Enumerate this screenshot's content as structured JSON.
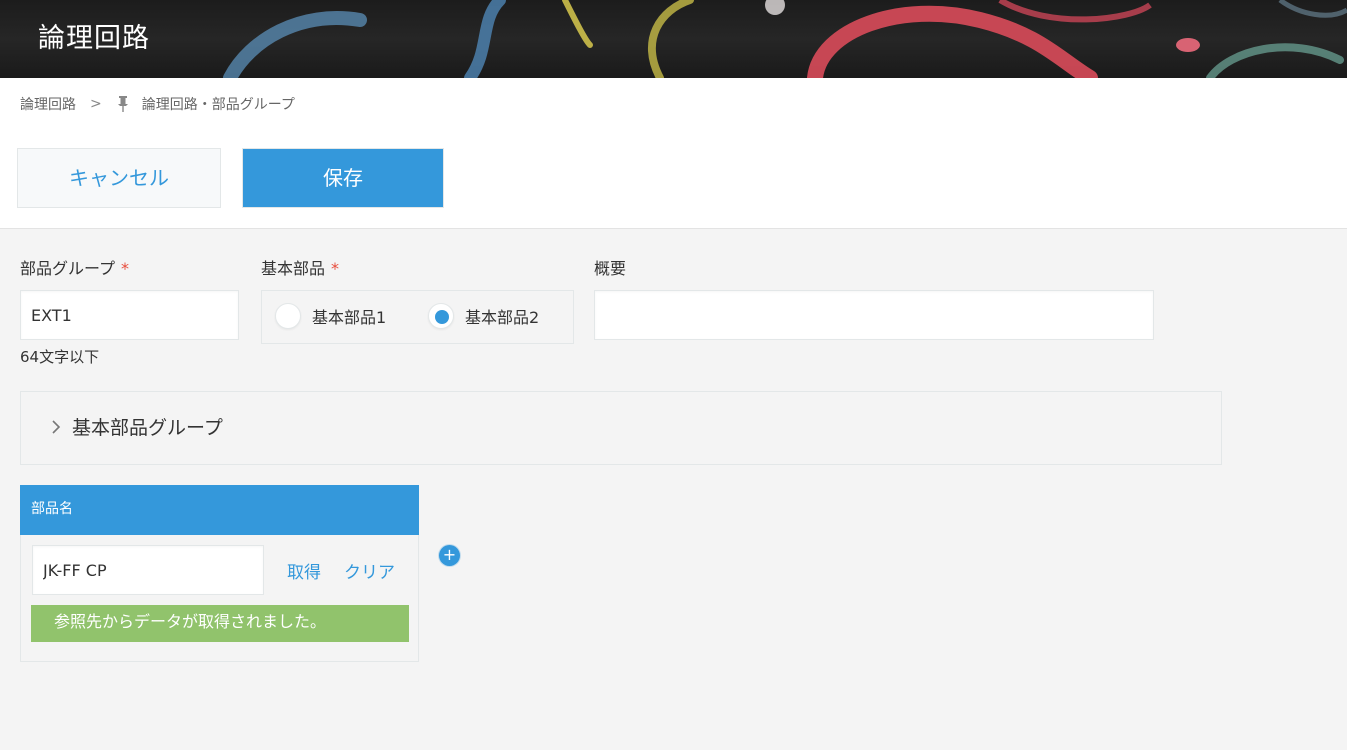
{
  "header": {
    "title": "論理回路"
  },
  "breadcrumb": {
    "parent": "論理回路",
    "separator": ">",
    "current": "論理回路・部品グループ"
  },
  "toolbar": {
    "cancel_label": "キャンセル",
    "save_label": "保存"
  },
  "form": {
    "group_label": "部品グループ",
    "group_required": "*",
    "group_value": "EXT1",
    "group_hint": "64文字以下",
    "basic_label": "基本部品",
    "basic_required": "*",
    "basic_options": [
      "基本部品1",
      "基本部品2"
    ],
    "basic_selected": "基本部品2",
    "summary_label": "概要",
    "summary_value": ""
  },
  "group_panel": {
    "title": "基本部品グループ"
  },
  "table": {
    "header": "部品名",
    "rows": [
      {
        "value": "JK-FF CP",
        "fetch_label": "取得",
        "clear_label": "クリア",
        "message": "参照先からデータが取得されました。"
      }
    ]
  },
  "icons": {
    "pin": "pin-icon",
    "chevron": "chevron-right-icon",
    "add": "plus-circle-icon"
  },
  "colors": {
    "accent": "#3498db",
    "success": "#91c36c",
    "required": "#e74c3c"
  }
}
